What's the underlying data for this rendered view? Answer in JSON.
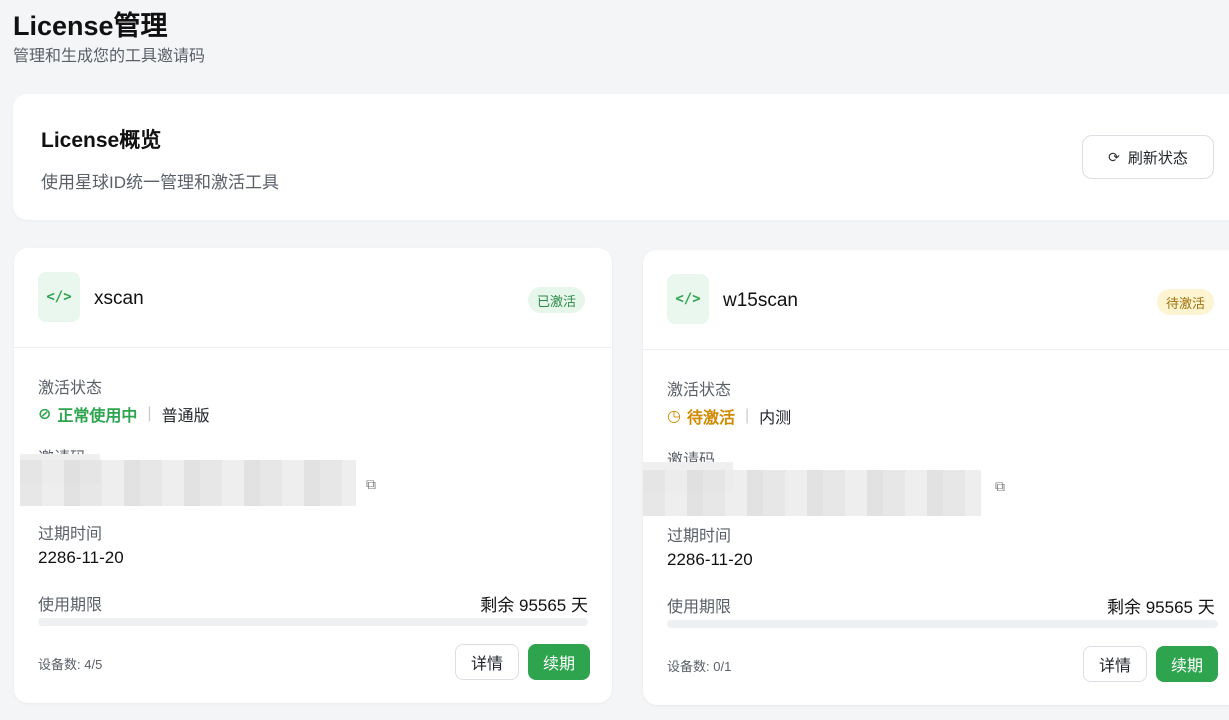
{
  "header": {
    "title": "License管理",
    "subtitle": "管理和生成您的工具邀请码"
  },
  "overview": {
    "title": "License概览",
    "description": "使用星球ID统一管理和激活工具",
    "refresh_label": "刷新状态",
    "refresh_icon": "refresh-icon"
  },
  "labels": {
    "activation_status": "激活状态",
    "invite_code": "邀请码",
    "expiry": "过期时间",
    "usage_period": "使用期限",
    "detail_button": "详情",
    "renew_button": "续期"
  },
  "licenses": [
    {
      "tool_icon": "</>",
      "name": "xscan",
      "badge": "已激活",
      "status_text": "正常使用中",
      "status_color": "#2ea44f",
      "status_icon": "check-circle-icon",
      "plan": "普通版",
      "expiry": "2286-11-20",
      "remaining": "剩余 95565 天",
      "progress": 0,
      "devices": "设备数: 4/5"
    },
    {
      "tool_icon": "</>",
      "name": "w15scan",
      "badge": "待激活",
      "status_text": "待激活",
      "status_color": "#d08a00",
      "status_icon": "clock-icon",
      "plan": "内测",
      "expiry": "2286-11-20",
      "remaining": "剩余 95565 天",
      "progress": 0,
      "devices": "设备数: 0/1"
    }
  ],
  "colors": {
    "accent": "#2ea44f",
    "warning": "#d08a00",
    "background": "#f4f5f7"
  }
}
